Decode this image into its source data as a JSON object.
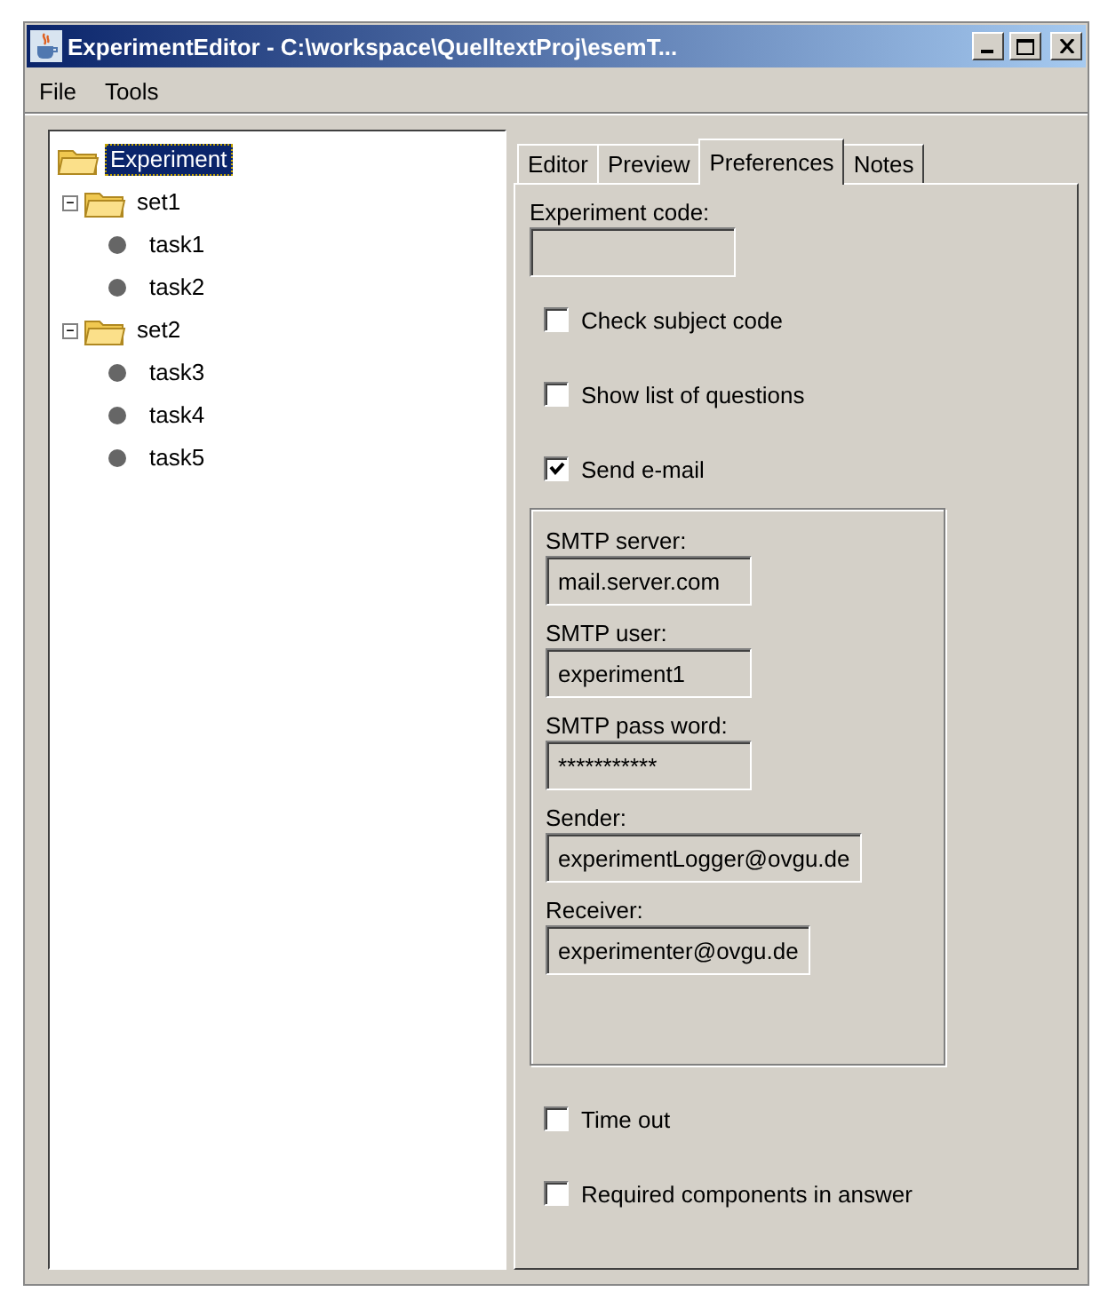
{
  "window": {
    "title": "ExperimentEditor - C:\\workspace\\QuelltextProj\\esemT..."
  },
  "menu": [
    "File",
    "Tools"
  ],
  "tree": [
    {
      "label": "Experiment",
      "selected": true,
      "children": [
        {
          "label": "set1",
          "selected": false,
          "expanded": true,
          "children": [
            {
              "label": "task1",
              "selected": false
            },
            {
              "label": "task2",
              "selected": false
            }
          ]
        },
        {
          "label": "set2",
          "selected": false,
          "expanded": true,
          "children": [
            {
              "label": "task3",
              "selected": false
            },
            {
              "label": "task4",
              "selected": false
            },
            {
              "label": "task5",
              "selected": false
            }
          ]
        }
      ]
    }
  ],
  "tabs": [
    {
      "label": "Editor",
      "selected": false
    },
    {
      "label": "Preview",
      "selected": false
    },
    {
      "label": "Preferences",
      "selected": true
    },
    {
      "label": "Notes",
      "selected": false
    }
  ],
  "preferences": [
    {
      "kind": "field",
      "label": "Experiment code:"
    },
    {
      "kind": "checkbox",
      "label": "Check subject code",
      "checked": false
    },
    {
      "kind": "checkbox",
      "label": "Show list of questions",
      "checked": false
    },
    {
      "kind": "checkbox",
      "label": "Send e-mail",
      "checked": true
    },
    {
      "kind": "group",
      "items": [
        {
          "kind": "field",
          "label": "SMTP server:",
          "value": "mail.server.com"
        },
        {
          "kind": "field",
          "label": "SMTP user:",
          "value": "experiment1"
        },
        {
          "kind": "field",
          "label": "SMTP pass word:",
          "value": "***********"
        },
        {
          "kind": "field",
          "label": "Sender:",
          "value": "experimentLogger@ovgu.de"
        },
        {
          "kind": "field",
          "label": "Receiver:",
          "value": "experimenter@ovgu.de"
        }
      ]
    },
    {
      "kind": "checkbox",
      "label": "Time out",
      "checked": false
    },
    {
      "kind": "checkbox",
      "label": "Required components in answer",
      "checked": false
    }
  ]
}
